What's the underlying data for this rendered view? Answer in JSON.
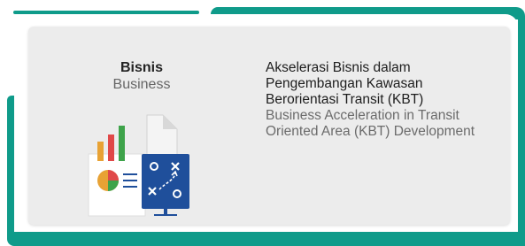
{
  "colors": {
    "frame": "#0f9b8a",
    "card": "#ececec",
    "text_primary": "#222222",
    "text_secondary": "#666666"
  },
  "category": {
    "label": "Bisnis",
    "label_en": "Business",
    "icon": "business-strategy-icon"
  },
  "item": {
    "title_id_lines": [
      "Akselerasi Bisnis dalam",
      "Pengembangan Kawasan",
      "Berorientasi Transit (KBT)"
    ],
    "title_en_lines": [
      "Business Acceleration in Transit",
      "Oriented Area (KBT)  Development"
    ]
  }
}
